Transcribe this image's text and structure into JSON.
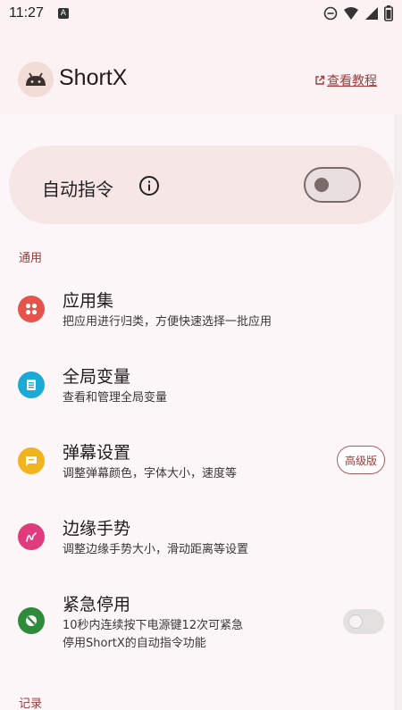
{
  "status_bar": {
    "time": "11:27",
    "notification_icon": "a-icon",
    "icons": [
      "dnd-icon",
      "wifi-icon",
      "signal-icon",
      "battery-icon"
    ]
  },
  "app_bar": {
    "title": "ShortX",
    "avatar_icon": "android-icon",
    "tutorial_link": "查看教程"
  },
  "auto_command": {
    "label": "自动指令",
    "info_icon": "info-icon",
    "enabled": false
  },
  "sections": {
    "general": "通用",
    "records": "记录"
  },
  "items": [
    {
      "title": "应用集",
      "subtitle": "把应用进行归类，方便快速选择一批应用",
      "icon": "apps-icon",
      "color": "#e5544b"
    },
    {
      "title": "全局变量",
      "subtitle": "查看和管理全局变量",
      "icon": "variable-icon",
      "color": "#1ba9d6"
    },
    {
      "title": "弹幕设置",
      "subtitle": "调整弹幕颜色，字体大小，速度等",
      "icon": "danmaku-icon",
      "color": "#f1b31e",
      "badge": "高级版"
    },
    {
      "title": "边缘手势",
      "subtitle": "调整边缘手势大小，滑动距离等设置",
      "icon": "gesture-icon",
      "color": "#e03b7d"
    },
    {
      "title": "紧急停用",
      "subtitle_line1": "10秒内连续按下电源键12次可紧急",
      "subtitle_line2": "停用ShortX的自动指令功能",
      "icon": "block-icon",
      "color": "#2e8b3a",
      "enabled": false
    }
  ]
}
